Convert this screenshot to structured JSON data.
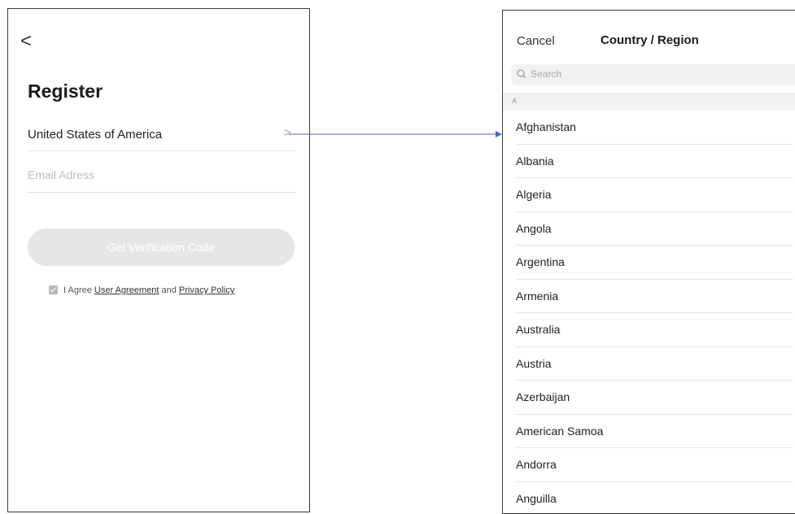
{
  "register_screen": {
    "back_glyph": "<",
    "title": "Register",
    "country_value": "United States of America",
    "chevron_glyph": ">",
    "email_placeholder": "Email Adress",
    "verify_button": "Get Verification Code",
    "agree_prefix": "I Agree",
    "user_agreement_link": "User Agreement",
    "agree_and": "and",
    "privacy_policy_link": "Privacy Policy"
  },
  "region_screen": {
    "cancel_label": "Cancel",
    "title": "Country / Region",
    "search_placeholder": "Search",
    "section_letter": "A",
    "countries": [
      "Afghanistan",
      "Albania",
      "Algeria",
      "Angola",
      "Argentina",
      "Armenia",
      "Australia",
      "Austria",
      "Azerbaijan",
      "American Samoa",
      "Andorra",
      "Anguilla"
    ]
  },
  "colors": {
    "arrow": "#3b6ec4",
    "disabled_button": "#e6e6e6",
    "screen_border": "#3a3a3a"
  }
}
